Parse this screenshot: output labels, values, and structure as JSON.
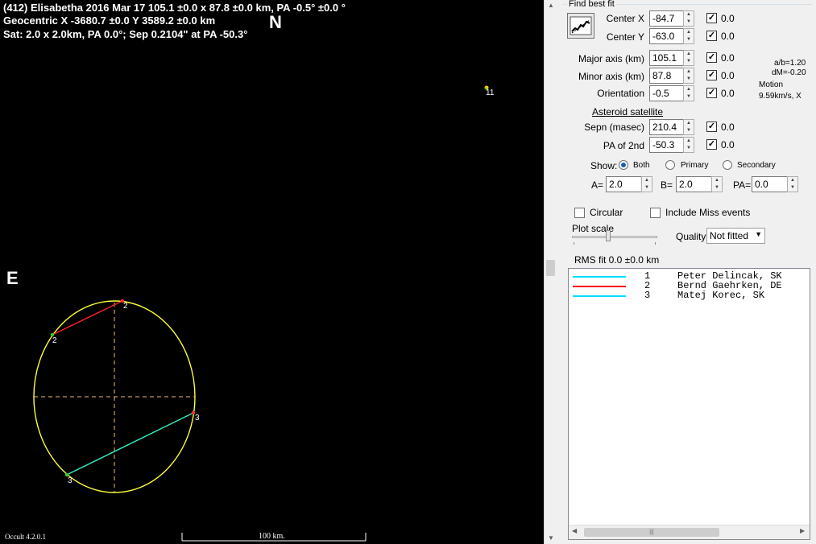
{
  "plot": {
    "header_line1": "(412) Elisabetha  2016 Mar 17  105.1 ±0.0 x 87.8 ±0.0 km, PA -0.5° ±0.0 °",
    "header_line2": "Geocentric  X  -3680.7 ±0.0  Y 3589.2 ±0.0 km",
    "header_line3": "Sat: 2.0 x 2.0km, PA 0.0°; Sep 0.2104\" at PA -50.3°",
    "north_label": "N",
    "east_label": "E",
    "satellite_label": "11",
    "chord_labels": [
      "2",
      "2",
      "3",
      "3"
    ],
    "version": "Occult 4.2.0.1",
    "scale_label": "100 km.",
    "colors": {
      "background": "#000000",
      "ellipse": "#ffff3a",
      "axes": "#f0c070",
      "chord_2": "#ff2020",
      "chord_3": "#30f0c0",
      "scale": "#ffffff"
    }
  },
  "panel": {
    "find_best_fit_title": "Find best fit",
    "params": [
      {
        "label": "Center X",
        "value": "-84.7",
        "checked": true,
        "uncertainty": "0.0"
      },
      {
        "label": "Center Y",
        "value": "-63.0",
        "checked": true,
        "uncertainty": "0.0"
      },
      {
        "label": "Major axis (km)",
        "value": "105.1",
        "checked": true,
        "uncertainty": "0.0"
      },
      {
        "label": "Minor axis (km)",
        "value": "87.8",
        "checked": true,
        "uncertainty": "0.0"
      },
      {
        "label": "Orientation",
        "value": "-0.5",
        "checked": true,
        "uncertainty": "0.0"
      }
    ],
    "ratio_text": "a/b=1.20",
    "dm_text": "dM=-0.20",
    "motion_label": "Motion",
    "motion_value": "9.59km/s, X",
    "satellite_heading": "Asteroid satellite",
    "sat_params": [
      {
        "label": "Sepn (masec)",
        "value": "210.4",
        "checked": true,
        "uncertainty": "0.0"
      },
      {
        "label": "PA of 2nd",
        "value": "-50.3",
        "checked": true,
        "uncertainty": "0.0"
      }
    ],
    "show_label": "Show:",
    "show_options": [
      "Both",
      "Primary",
      "Secondary"
    ],
    "show_selected": "Both",
    "a_label": "A=",
    "a_value": "2.0",
    "b_label": "B=",
    "b_value": "2.0",
    "pa_label": "PA=",
    "pa_value": "0.0",
    "circular_label": "Circular",
    "include_miss_label": "Include Miss events",
    "plot_scale_label": "Plot scale",
    "quality_label": "Quality",
    "quality_value": "Not fitted",
    "rms_text": "RMS fit 0.0 ±0.0 km",
    "observers": [
      {
        "no": "1",
        "name": "Peter Delincak, SK",
        "color": "#00e0ff"
      },
      {
        "no": "2",
        "name": "Bernd Gaehrken, DE",
        "color": "#ff0000"
      },
      {
        "no": "3",
        "name": "Matej Korec, SK",
        "color": "#00e0ff"
      }
    ]
  }
}
